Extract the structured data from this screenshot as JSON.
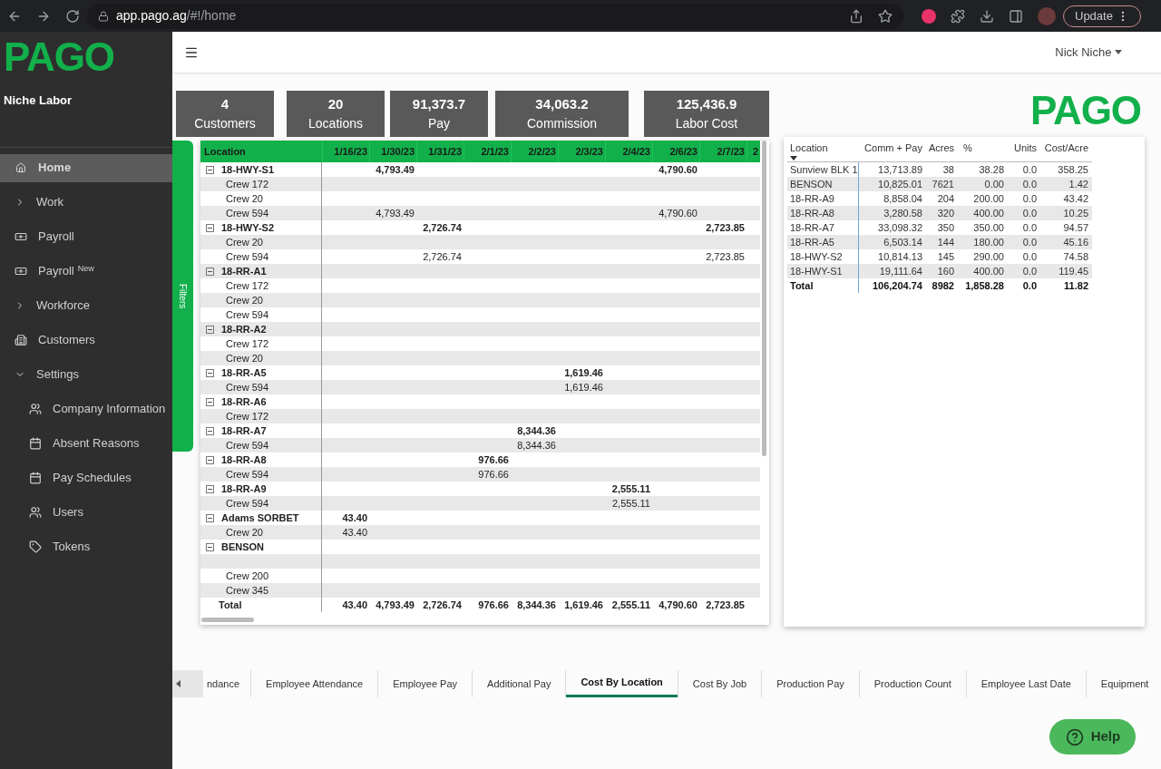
{
  "browser": {
    "url_host": "app.pago.ag",
    "url_path": "/#!/home",
    "update_button": "Update"
  },
  "sidebar": {
    "logo": "PAGO",
    "company": "Niche Labor",
    "items": [
      {
        "label": "Home",
        "kind": "home",
        "selected": true
      },
      {
        "label": "Work",
        "kind": "caret",
        "expanded": false,
        "selected": false
      },
      {
        "label": "Payroll",
        "kind": "money",
        "selected": false
      },
      {
        "label": "Payroll",
        "badge": "New",
        "kind": "money",
        "selected": false
      },
      {
        "label": "Workforce",
        "kind": "caret",
        "expanded": false,
        "selected": false
      },
      {
        "label": "Customers",
        "kind": "building",
        "selected": false
      },
      {
        "label": "Settings",
        "kind": "caret",
        "expanded": true,
        "selected": false,
        "children": [
          {
            "label": "Company Information",
            "kind": "users",
            "selected": false
          },
          {
            "label": "Absent Reasons",
            "kind": "calendar",
            "selected": false
          },
          {
            "label": "Pay Schedules",
            "kind": "calendar",
            "selected": false
          },
          {
            "label": "Users",
            "kind": "users",
            "selected": false
          },
          {
            "label": "Tokens",
            "kind": "tag",
            "selected": false
          }
        ]
      }
    ]
  },
  "topbar": {
    "user": "Nick Niche"
  },
  "kpis": [
    {
      "value": "4",
      "label": "Customers"
    },
    {
      "value": "20",
      "label": "Locations"
    },
    {
      "value": "91,373.7",
      "label": "Pay"
    },
    {
      "value": "34,063.2",
      "label": "Commission"
    },
    {
      "value": "125,436.9",
      "label": "Labor Cost"
    }
  ],
  "logo": "PAGO",
  "filters_tab": "Filters",
  "matrix": {
    "row_header": "Location",
    "columns": [
      "1/16/23",
      "1/30/23",
      "1/31/23",
      "2/1/23",
      "2/2/23",
      "2/3/23",
      "2/4/23",
      "2/6/23",
      "2/7/23",
      "2"
    ],
    "groups": [
      {
        "label": "18-HWY-S1",
        "expanded": true,
        "cells": [
          {
            "kind": "empty"
          },
          {
            "kind": "amount",
            "text": "4,793.49"
          },
          {
            "kind": "empty"
          },
          {
            "kind": "empty"
          },
          {
            "kind": "empty"
          },
          {
            "kind": "empty"
          },
          {
            "kind": "empty"
          },
          {
            "kind": "amount",
            "text": "4,790.60"
          }
        ],
        "children": [
          {
            "label": "Crew 172"
          },
          {
            "label": "Crew 20"
          },
          {
            "label": "Crew 594",
            "cells": [
              {
                "kind": "empty"
              },
              {
                "kind": "amount",
                "text": "4,793.49"
              },
              {
                "kind": "empty"
              },
              {
                "kind": "empty"
              },
              {
                "kind": "empty"
              },
              {
                "kind": "empty"
              },
              {
                "kind": "empty"
              },
              {
                "kind": "amount",
                "text": "4,790.60"
              }
            ]
          }
        ]
      },
      {
        "label": "18-HWY-S2",
        "expanded": true,
        "cells": [
          {
            "kind": "empty"
          },
          {
            "kind": "empty"
          },
          {
            "kind": "amount",
            "text": "2,726.74"
          },
          {
            "kind": "empty"
          },
          {
            "kind": "empty"
          },
          {
            "kind": "empty"
          },
          {
            "kind": "empty"
          },
          {
            "kind": "empty"
          },
          {
            "kind": "amount",
            "text": "2,723.85"
          }
        ],
        "children": [
          {
            "label": "Crew 20"
          },
          {
            "label": "Crew 594",
            "cells": [
              {
                "kind": "empty"
              },
              {
                "kind": "empty"
              },
              {
                "kind": "amount",
                "text": "2,726.74"
              },
              {
                "kind": "empty"
              },
              {
                "kind": "empty"
              },
              {
                "kind": "empty"
              },
              {
                "kind": "empty"
              },
              {
                "kind": "empty"
              },
              {
                "kind": "amount",
                "text": "2,723.85"
              }
            ]
          }
        ]
      },
      {
        "label": "18-RR-A1",
        "expanded": true,
        "children": [
          {
            "label": "Crew 172"
          },
          {
            "label": "Crew 20"
          },
          {
            "label": "Crew 594"
          }
        ]
      },
      {
        "label": "18-RR-A2",
        "expanded": true,
        "children": [
          {
            "label": "Crew 172"
          },
          {
            "label": "Crew 20"
          }
        ]
      },
      {
        "label": "18-RR-A5",
        "expanded": true,
        "cells": [
          {
            "kind": "empty"
          },
          {
            "kind": "empty"
          },
          {
            "kind": "empty"
          },
          {
            "kind": "empty"
          },
          {
            "kind": "empty"
          },
          {
            "kind": "amount",
            "text": "1,619.46"
          }
        ],
        "children": [
          {
            "label": "Crew 594",
            "cells": [
              {
                "kind": "empty"
              },
              {
                "kind": "empty"
              },
              {
                "kind": "empty"
              },
              {
                "kind": "empty"
              },
              {
                "kind": "empty"
              },
              {
                "kind": "amount",
                "text": "1,619.46"
              }
            ]
          }
        ]
      },
      {
        "label": "18-RR-A6",
        "expanded": true,
        "children": [
          {
            "label": "Crew 172"
          }
        ]
      },
      {
        "label": "18-RR-A7",
        "expanded": true,
        "cells": [
          {
            "kind": "empty"
          },
          {
            "kind": "empty"
          },
          {
            "kind": "empty"
          },
          {
            "kind": "empty"
          },
          {
            "kind": "amount",
            "text": "8,344.36"
          }
        ],
        "children": [
          {
            "label": "Crew 594",
            "cells": [
              {
                "kind": "empty"
              },
              {
                "kind": "empty"
              },
              {
                "kind": "empty"
              },
              {
                "kind": "empty"
              },
              {
                "kind": "amount",
                "text": "8,344.36"
              }
            ]
          }
        ]
      },
      {
        "label": "18-RR-A8",
        "expanded": true,
        "cells": [
          {
            "kind": "empty"
          },
          {
            "kind": "empty"
          },
          {
            "kind": "empty"
          },
          {
            "kind": "amount",
            "text": "976.66"
          }
        ],
        "children": [
          {
            "label": "Crew 594",
            "cells": [
              {
                "kind": "empty"
              },
              {
                "kind": "empty"
              },
              {
                "kind": "empty"
              },
              {
                "kind": "amount",
                "text": "976.66"
              }
            ]
          }
        ]
      },
      {
        "label": "18-RR-A9",
        "expanded": true,
        "cells": [
          {
            "kind": "empty"
          },
          {
            "kind": "empty"
          },
          {
            "kind": "empty"
          },
          {
            "kind": "empty"
          },
          {
            "kind": "empty"
          },
          {
            "kind": "empty"
          },
          {
            "kind": "amount",
            "text": "2,555.11"
          }
        ],
        "children": [
          {
            "label": "Crew 594",
            "cells": [
              {
                "kind": "empty"
              },
              {
                "kind": "empty"
              },
              {
                "kind": "empty"
              },
              {
                "kind": "empty"
              },
              {
                "kind": "empty"
              },
              {
                "kind": "empty"
              },
              {
                "kind": "amount",
                "text": "2,555.11"
              }
            ]
          }
        ]
      },
      {
        "label": "Adams SORBET",
        "expanded": true,
        "cells": [
          {
            "kind": "amount",
            "text": "43.40"
          }
        ],
        "children": [
          {
            "label": "Crew 20",
            "cells": [
              {
                "kind": "amount",
                "text": "43.40"
              }
            ]
          }
        ]
      },
      {
        "label": "BENSON",
        "expanded": true,
        "children": [
          {
            "kind": "blank"
          },
          {
            "label": "Crew 200"
          },
          {
            "label": "Crew 345"
          }
        ]
      }
    ],
    "total": {
      "label": "Total",
      "cells": [
        {
          "kind": "amount",
          "text": "43.40"
        },
        {
          "kind": "amount",
          "text": "4,793.49"
        },
        {
          "kind": "amount",
          "text": "2,726.74"
        },
        {
          "kind": "amount",
          "text": "976.66"
        },
        {
          "kind": "amount",
          "text": "8,344.36"
        },
        {
          "kind": "amount",
          "text": "1,619.46"
        },
        {
          "kind": "amount",
          "text": "2,555.11"
        },
        {
          "kind": "amount",
          "text": "4,790.60"
        },
        {
          "kind": "amount",
          "text": "2,723.85"
        }
      ]
    }
  },
  "summary": {
    "columns": [
      "Location",
      "Comm + Pay",
      "Acres",
      "%",
      "Units",
      "Cost/Acre"
    ],
    "rows": [
      [
        "Sunview BLK 1",
        "13,713.89",
        "38",
        "38.28",
        "0.0",
        "358.25"
      ],
      [
        "BENSON",
        "10,825.01",
        "7621",
        "0.00",
        "0.0",
        "1.42"
      ],
      [
        "18-RR-A9",
        "8,858.04",
        "204",
        "200.00",
        "0.0",
        "43.42"
      ],
      [
        "18-RR-A8",
        "3,280.58",
        "320",
        "400.00",
        "0.0",
        "10.25"
      ],
      [
        "18-RR-A7",
        "33,098.32",
        "350",
        "350.00",
        "0.0",
        "94.57"
      ],
      [
        "18-RR-A5",
        "6,503.14",
        "144",
        "180.00",
        "0.0",
        "45.16"
      ],
      [
        "18-HWY-S2",
        "10,814.13",
        "145",
        "290.00",
        "0.0",
        "74.58"
      ],
      [
        "18-HWY-S1",
        "19,111.64",
        "160",
        "400.00",
        "0.0",
        "119.45"
      ]
    ],
    "total": [
      "Total",
      "106,204.74",
      "8982",
      "1,858.28",
      "0.0",
      "11.82"
    ]
  },
  "report_tabs": [
    {
      "label": "ndance",
      "selected": false
    },
    {
      "label": "Employee Attendance",
      "selected": false
    },
    {
      "label": "Employee Pay",
      "selected": false
    },
    {
      "label": "Additional Pay",
      "selected": false
    },
    {
      "label": "Cost By Location",
      "selected": true
    },
    {
      "label": "Cost By Job",
      "selected": false
    },
    {
      "label": "Production Pay",
      "selected": false
    },
    {
      "label": "Production Count",
      "selected": false
    },
    {
      "label": "Employee Last Date",
      "selected": false
    },
    {
      "label": "Equipment",
      "selected": false
    }
  ],
  "help_button": "Help"
}
